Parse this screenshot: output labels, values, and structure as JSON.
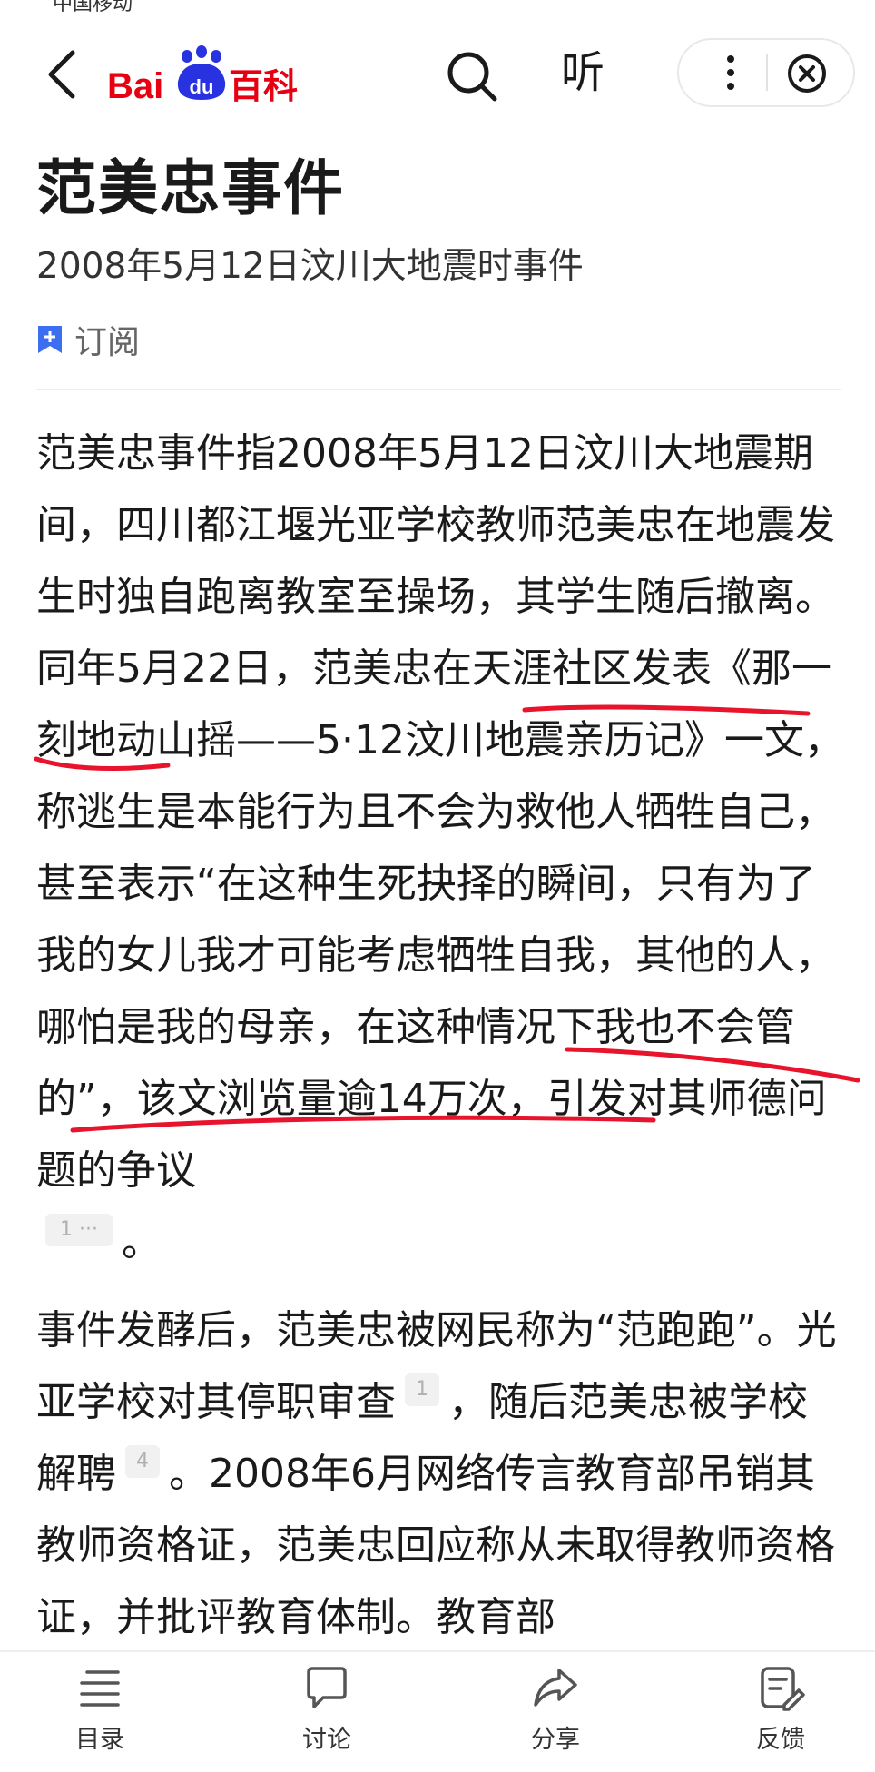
{
  "status": {
    "carrier": "中国移动"
  },
  "header": {
    "logo": {
      "bai": "Bai",
      "du": "du",
      "baike": "百科"
    },
    "listen_label": "听"
  },
  "article": {
    "title": "范美忠事件",
    "subtitle": "2008年5月12日汶川大地震时事件",
    "subscribe_label": "订阅",
    "para1": {
      "t1": "范美忠事件指2008年5月12日汶川大地震期间，四川都江堰光亚学校教师范美忠在地震发生时独自跑离教室至操场，其学生随后撤离。同年5月22日，",
      "t2": "范美忠在天涯社区发表",
      "t3": "《那一刻地动山摇——5·12汶川地震亲历记》一文，称逃生是本能行为且不会为救他人牺牲自己，甚至表示“在这种生死抉择的瞬间，只有为了我的女儿我才可能考虑牺牲自我，其他的人，",
      "t4": "哪怕是我的母亲，在这种情况下我也不会管的",
      "t5": "”，该文浏览量逾14万次，引发对其师德问题的争议",
      "cite": "1 ···",
      "t6": "。"
    },
    "para2": {
      "t1": "事件发酵后，范美忠被网民称为“范跑跑”。光亚学校对其停职审查",
      "cite1": "1",
      "t2": "，随后范美忠被学校解聘",
      "cite2": "4",
      "t3": "。2008年6月网络传言教育部吊销其教师资格证，范美忠回应称从未取得教师资格证，并批评教育体制。教育部"
    }
  },
  "bottom_bar": {
    "items": [
      {
        "label": "目录",
        "icon": "menu-icon"
      },
      {
        "label": "讨论",
        "icon": "chat-bubble-icon"
      },
      {
        "label": "分享",
        "icon": "share-arrow-icon"
      },
      {
        "label": "反馈",
        "icon": "feedback-edit-icon"
      }
    ]
  },
  "colors": {
    "brand_red": "#e60012",
    "brand_blue": "#2932e1",
    "accent_blue": "#3c6ff0",
    "annotation_red": "#e8142c"
  }
}
